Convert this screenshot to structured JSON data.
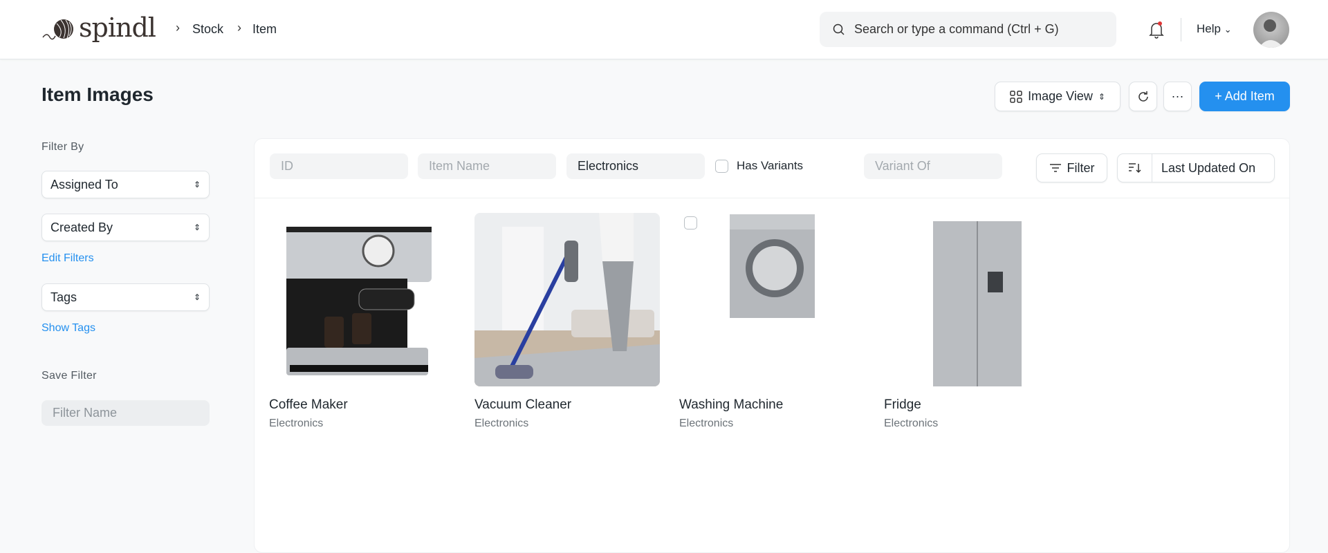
{
  "header": {
    "logo_text": "spindl",
    "breadcrumbs": [
      "Stock",
      "Item"
    ],
    "search_placeholder": "Search or type a command (Ctrl + G)",
    "help_label": "Help",
    "notification_dot_color": "#e03636"
  },
  "page": {
    "title": "Item Images",
    "view_label": "Image View",
    "add_label": "+ Add Item",
    "accent": "#2490ef"
  },
  "sidebar": {
    "filter_by": "Filter By",
    "selects": [
      "Assigned To",
      "Created By"
    ],
    "edit_filters": "Edit Filters",
    "tags": "Tags",
    "show_tags": "Show Tags",
    "save_filter": "Save Filter",
    "filter_name_placeholder": "Filter Name"
  },
  "filters": {
    "id_placeholder": "ID",
    "item_name_placeholder": "Item Name",
    "item_group_value": "Electronics",
    "has_variants": "Has Variants",
    "variant_of_placeholder": "Variant Of",
    "filter_label": "Filter",
    "sort_label": "Last Updated On"
  },
  "items": [
    {
      "name": "Coffee Maker",
      "group": "Electronics"
    },
    {
      "name": "Vacuum Cleaner",
      "group": "Electronics"
    },
    {
      "name": "Washing Machine",
      "group": "Electronics"
    },
    {
      "name": "Fridge",
      "group": "Electronics"
    }
  ]
}
